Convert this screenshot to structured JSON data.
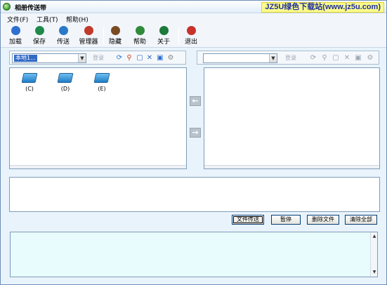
{
  "window": {
    "title": "相册传送带",
    "watermark": "JZ5U绿色下载站(www.jz5u.com)"
  },
  "menu": [
    "文件(F)",
    "工具(T)",
    "帮助(H)"
  ],
  "toolbar": {
    "buttons": [
      {
        "label": "加载",
        "icon": "load-icon",
        "color": "#2f6fd0"
      },
      {
        "label": "保存",
        "icon": "save-icon",
        "color": "#1e8a4a"
      },
      {
        "label": "传送",
        "icon": "send-icon",
        "color": "#2a78c8"
      },
      {
        "label": "管理器",
        "icon": "manager-icon",
        "color": "#c23a2a"
      },
      {
        "label": "隐藏",
        "icon": "hide-icon",
        "color": "#7a4b22"
      },
      {
        "label": "帮助",
        "icon": "help-icon",
        "color": "#2f8a3a"
      },
      {
        "label": "关于",
        "icon": "about-icon",
        "color": "#1c7a3a"
      },
      {
        "label": "退出",
        "icon": "exit-icon",
        "color": "#c8322a"
      }
    ]
  },
  "local": {
    "path_value": "本地1...",
    "login_label": "登录",
    "drives": [
      "(C)",
      "(D)",
      "(E)"
    ]
  },
  "remote": {
    "path_value": "",
    "login_label": "登录"
  },
  "actions": {
    "send_files": "文件传送",
    "pause": "暂停",
    "delete_files": "删除文件",
    "clear_all": "清除全部"
  },
  "colors": {
    "window_bg": "#e9f3fb",
    "selection": "#3169c6",
    "log_bg": "#e8fbfd",
    "watermark_bg": "#fbfb8e"
  }
}
